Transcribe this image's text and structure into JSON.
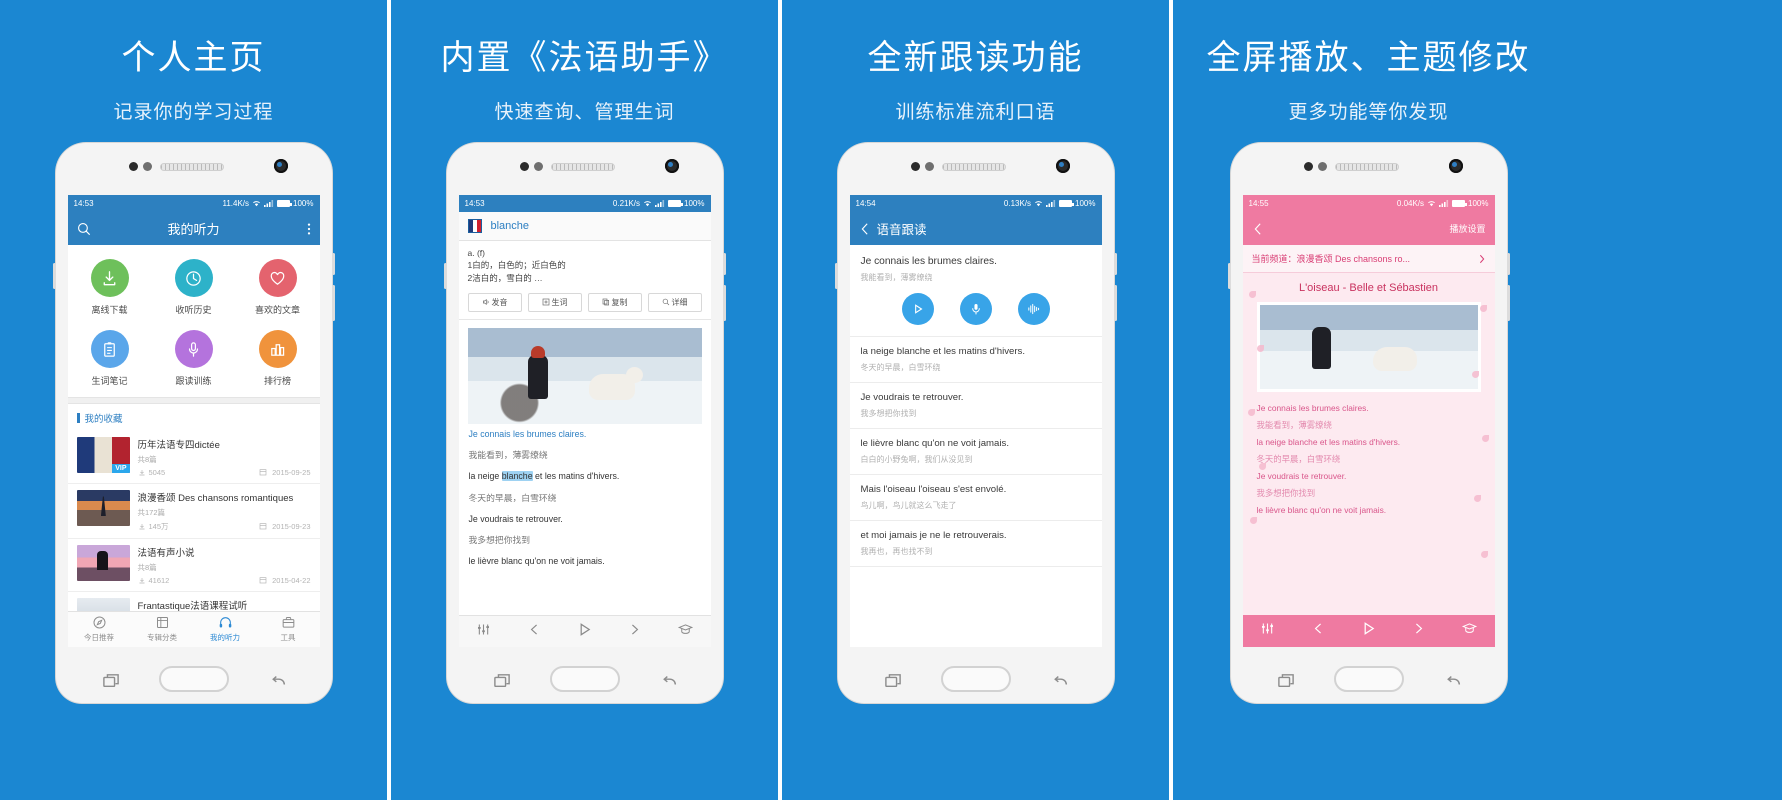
{
  "panels": [
    {
      "headline": "个人主页",
      "subhead": "记录你的学习过程",
      "status": {
        "time": "14:53",
        "speed": "11.4K/s",
        "battery": "100%"
      },
      "appbar": {
        "title": "我的听力",
        "search_icon": "search-icon",
        "more_icon": "more-vertical-icon"
      },
      "grid": [
        {
          "label": "离线下载",
          "icon": "download-icon",
          "color": "#6ec05b"
        },
        {
          "label": "收听历史",
          "icon": "clock-icon",
          "color": "#2db2c9"
        },
        {
          "label": "喜欢的文章",
          "icon": "heart-icon",
          "color": "#e4636e"
        },
        {
          "label": "生词笔记",
          "icon": "notebook-icon",
          "color": "#5aa6ea"
        },
        {
          "label": "跟读训练",
          "icon": "microphone-icon",
          "color": "#b473dd"
        },
        {
          "label": "排行榜",
          "icon": "bar-chart-icon",
          "color": "#f0933c"
        }
      ],
      "section_title": "我的收藏",
      "favorites": [
        {
          "title": "历年法语专四dictée",
          "count": "共8篇",
          "plays": "5045",
          "date": "2015-09-25",
          "vip": "VIP",
          "thumb": "flag"
        },
        {
          "title": "浪漫香颂 Des chansons romantiques",
          "count": "共172篇",
          "plays": "145万",
          "date": "2015-09-23",
          "vip": "",
          "thumb": "tower"
        },
        {
          "title": "法语有声小说",
          "count": "共8篇",
          "plays": "41612",
          "date": "2015-04-22",
          "vip": "",
          "thumb": "couple"
        },
        {
          "title": "Frantastique法语课程试听",
          "count": "",
          "plays": "",
          "date": "",
          "vip": "",
          "thumb": "frantastique"
        }
      ],
      "tabs": [
        {
          "label": "今日推荐",
          "icon": "compass-icon",
          "active": false
        },
        {
          "label": "专辑分类",
          "icon": "book-icon",
          "active": false
        },
        {
          "label": "我的听力",
          "icon": "headphones-icon",
          "active": true
        },
        {
          "label": "工具",
          "icon": "toolbox-icon",
          "active": false
        }
      ]
    },
    {
      "headline": "内置《法语助手》",
      "subhead": "快速查询、管理生词",
      "status": {
        "time": "14:53",
        "speed": "0.21K/s",
        "battery": "100%"
      },
      "dict": {
        "flag_icon": "french-flag-icon",
        "word": "blanche",
        "pos": "a. (f)",
        "def1": "1白的，白色的；近白色的",
        "def2": "2洁白的，雪白的 …",
        "buttons": [
          {
            "label": "发音",
            "icon": "speaker-icon"
          },
          {
            "label": "生词",
            "icon": "plus-icon"
          },
          {
            "label": "复制",
            "icon": "copy-icon"
          },
          {
            "label": "详细",
            "icon": "search-icon"
          }
        ]
      },
      "lyrics": [
        {
          "fr": "Je connais les brumes claires.",
          "cn": "我能看到，薄雾缭绕",
          "style": "link"
        },
        {
          "fr": "la neige blanche et les matins d'hivers.",
          "cn": "冬天的早晨，白雪环绕",
          "style": "dark",
          "highlight": "blanche"
        },
        {
          "fr": "Je voudrais te retrouver.",
          "cn": "我多想把你找到",
          "style": "dark"
        },
        {
          "fr": "le lièvre blanc qu'on ne voit jamais.",
          "cn": "",
          "style": "dark"
        }
      ],
      "bottom_icons": [
        "sliders-icon",
        "previous-icon",
        "play-icon",
        "next-icon",
        "graduation-cap-icon"
      ]
    },
    {
      "headline": "全新跟读功能",
      "subhead": "训练标准流利口语",
      "status": {
        "time": "14:54",
        "speed": "0.13K/s",
        "battery": "100%"
      },
      "appbar": {
        "title": "语音跟读",
        "back_icon": "chevron-left-icon"
      },
      "active_sentence": {
        "fr": "Je connais les brumes claires.",
        "cn": "我能看到，薄雾缭绕"
      },
      "rec_buttons": [
        {
          "icon": "play-icon",
          "name": "play-button"
        },
        {
          "icon": "microphone-icon",
          "name": "record-button"
        },
        {
          "icon": "waveform-icon",
          "name": "waveform-button"
        }
      ],
      "sentences": [
        {
          "fr": "la neige blanche et les matins d'hivers.",
          "cn": "冬天的早晨，白雪环绕"
        },
        {
          "fr": "Je voudrais te retrouver.",
          "cn": "我多想把你找到"
        },
        {
          "fr": "le lièvre blanc qu'on ne voit jamais.",
          "cn": "白白的小野兔啊，我们从没见到"
        },
        {
          "fr": "Mais l'oiseau l'oiseau s'est envolé.",
          "cn": "鸟儿啊，鸟儿就这么飞走了"
        },
        {
          "fr": "et moi jamais je ne le retrouverais.",
          "cn": "我再也，再也找不到"
        }
      ]
    },
    {
      "headline": "全屏播放、主题修改",
      "subhead": "更多功能等你发现",
      "status": {
        "time": "14:55",
        "speed": "0.04K/s",
        "battery": "100%"
      },
      "appbar": {
        "back_icon": "chevron-left-icon",
        "action": "播放设置"
      },
      "channel": {
        "label": "当前频道：浪漫香颂 Des chansons ro...",
        "chevron": "chevron-right-icon"
      },
      "track_title": "L'oiseau - Belle et Sébastien",
      "lyrics": [
        {
          "fr": "Je connais les brumes claires.",
          "cn": "我能看到，薄雾缭绕"
        },
        {
          "fr": "la neige blanche et les matins d'hivers.",
          "cn": "冬天的早晨，白雪环绕"
        },
        {
          "fr": "Je voudrais te retrouver.",
          "cn": "我多想把你找到"
        },
        {
          "fr": "le lièvre blanc qu'on ne voit jamais.",
          "cn": ""
        }
      ],
      "bottom_icons": [
        "sliders-icon",
        "previous-icon",
        "play-icon",
        "next-icon",
        "graduation-cap-icon"
      ],
      "theme_color": "#ef7aa1"
    }
  ],
  "colors": {
    "brand_blue": "#1b87d2",
    "appbar_blue": "#2d80bf",
    "pink": "#ef7aa1",
    "accent_link": "#2d7fc2"
  }
}
